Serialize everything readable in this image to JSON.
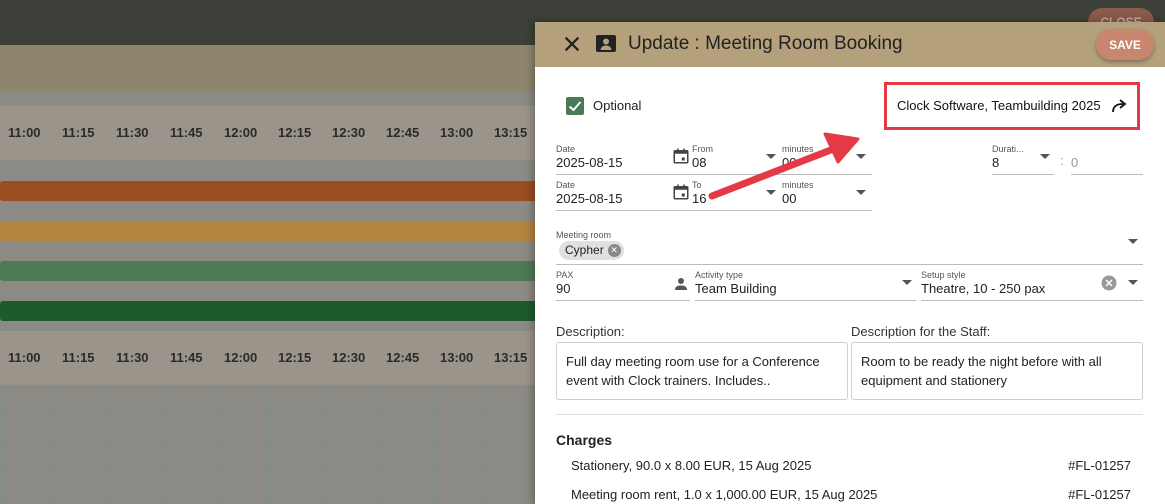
{
  "background": {
    "close_label": "CLOSE",
    "times": [
      "11:00",
      "11:15",
      "11:30",
      "11:45",
      "12:00",
      "12:15",
      "12:30",
      "12:45",
      "13:00",
      "13:15"
    ],
    "bar_colors": [
      "#9a4e22",
      "#b3843f",
      "#4c7a55",
      "#1e5b2b"
    ]
  },
  "dialog": {
    "title": "Update : Meeting Room Booking",
    "save_label": "SAVE",
    "optional_label": "Optional",
    "optional_checked": true,
    "booking_link": "Clock Software, Teambuilding 2025",
    "from": {
      "date_label": "Date",
      "date_value": "2025-08-15",
      "hour_label": "From",
      "hour_value": "08",
      "minutes_label": "minutes",
      "minutes_value": "00"
    },
    "to": {
      "date_label": "Date",
      "date_value": "2025-08-15",
      "hour_label": "To",
      "hour_value": "16",
      "minutes_label": "minutes",
      "minutes_value": "00"
    },
    "duration": {
      "label": "Durati...",
      "value": "8",
      "separator": ":",
      "minutes_value": "0"
    },
    "meeting_room": {
      "label": "Meeting room",
      "chip": "Cypher"
    },
    "pax": {
      "label": "PAX",
      "value": "90"
    },
    "activity": {
      "label": "Activity type",
      "value": "Team Building"
    },
    "setup": {
      "label": "Setup style",
      "value": "Theatre, 10 - 250 pax"
    },
    "description": {
      "label": "Description:",
      "text": "Full day meeting room use for a Conference event with Clock trainers. Includes.."
    },
    "staff_description": {
      "label": "Description for the Staff:",
      "text": "Room to be ready the night before with all equipment and stationery"
    },
    "charges": {
      "heading": "Charges",
      "rows": [
        {
          "text": "Stationery, 90.0 x 8.00 EUR, 15 Aug 2025",
          "ref": "#FL-01257"
        },
        {
          "text": "Meeting room rent, 1.0 x 1,000.00 EUR, 15 Aug 2025",
          "ref": "#FL-01257"
        }
      ]
    }
  },
  "colors": {
    "header": "#b4a17c",
    "save": "#c9866e",
    "annotation": "#e63946",
    "checkbox": "#4a7a55"
  }
}
